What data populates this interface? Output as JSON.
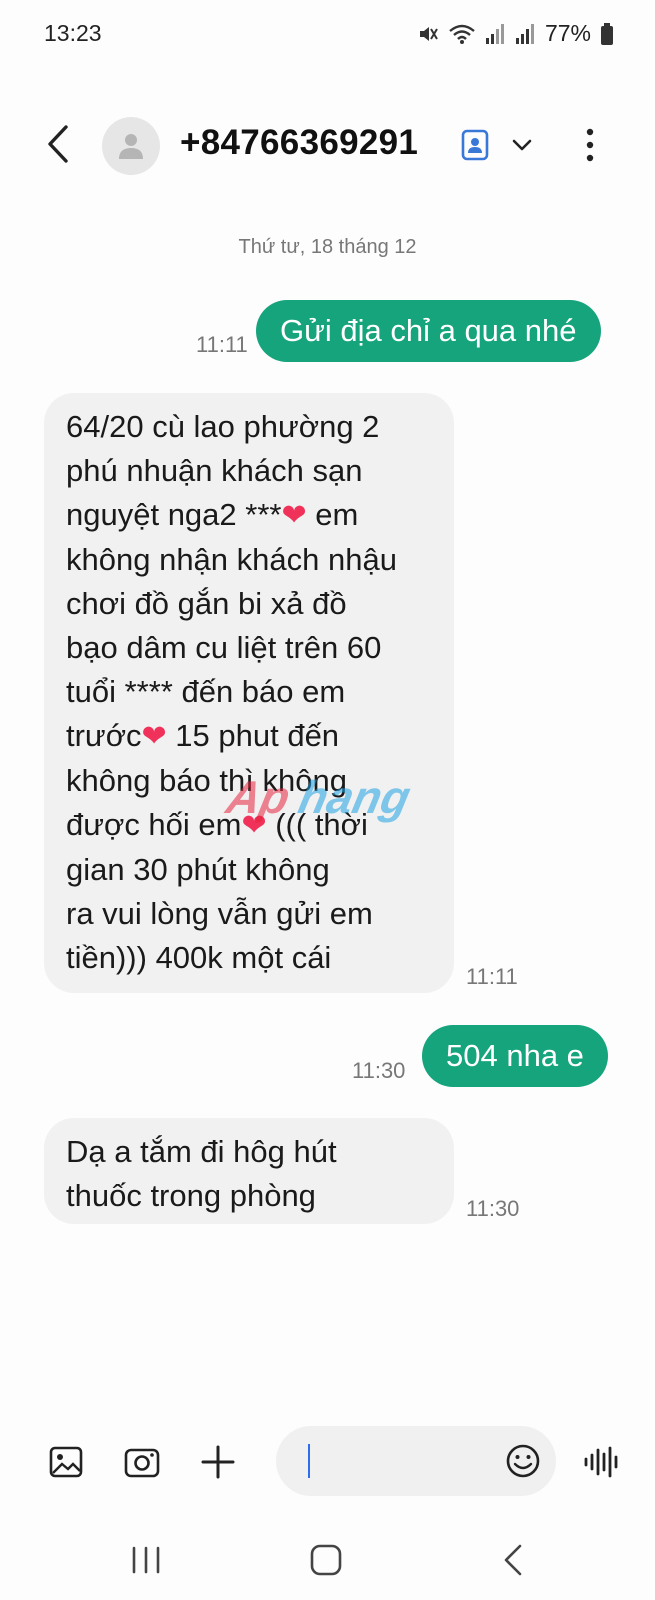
{
  "status_bar": {
    "time": "13:23",
    "battery": "77%",
    "icons": [
      "mute-icon",
      "wifi-icon",
      "signal-icon",
      "signal-icon",
      "battery-icon"
    ]
  },
  "header": {
    "contact": "+84766369291",
    "icons": [
      "back-icon",
      "avatar-person-icon",
      "contact-card-icon",
      "chevron-down-icon",
      "more-vertical-icon"
    ]
  },
  "conversation": {
    "date": "Thứ tư, 18 tháng 12",
    "messages": [
      {
        "direction": "outgoing",
        "lines": [
          "Gửi địa chỉ a qua nhé"
        ],
        "time": "11:11"
      },
      {
        "direction": "incoming",
        "lines": [
          "64/20 cù lao phường 2",
          "phú nhuận khách sạn",
          "nguyệt nga2 ***❤️ em",
          "không nhận khách nhậu",
          "chơi đồ gắn bi xả đồ",
          "bạo dâm cu liệt trên 60",
          "tuổi **** đến báo em",
          "trước❤️ 15 phut đến",
          "không báo thì không",
          "được hối em❤️ ((( thời",
          "gian 30 phút không",
          "ra vui lòng vẫn gửi em",
          "tiền))) 400k một cái"
        ],
        "time": "11:11"
      },
      {
        "direction": "outgoing",
        "lines": [
          "504 nha e"
        ],
        "time": "11:30"
      },
      {
        "direction": "incoming",
        "lines": [
          "Dạ a tắm đi hôg hút",
          "thuốc trong phòng"
        ],
        "time": "11:30"
      }
    ]
  },
  "watermark": {
    "part1": "Ap",
    "part2": "hang"
  },
  "composer": {
    "icons": [
      "gallery-icon",
      "camera-icon",
      "plus-icon",
      "emoji-icon",
      "voice-icon"
    ]
  },
  "nav_bar": {
    "icons": [
      "recent-apps-icon",
      "home-icon",
      "back-nav-icon"
    ]
  },
  "colors": {
    "outgoing_bubble": "#16a47c",
    "incoming_bubble": "#f1f1f1",
    "caret": "#2f6df0"
  }
}
